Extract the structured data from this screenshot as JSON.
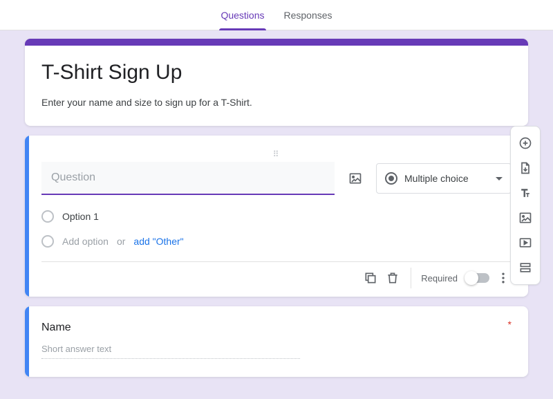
{
  "tabs": {
    "questions": "Questions",
    "responses": "Responses"
  },
  "header": {
    "title": "T-Shirt Sign Up",
    "description": "Enter your name and size to sign up for a T-Shirt."
  },
  "question": {
    "placeholder": "Question",
    "type_label": "Multiple choice",
    "option1": "Option 1",
    "add_option": "Add option",
    "or_text": "or",
    "add_other": "add \"Other\"",
    "required_label": "Required"
  },
  "name_card": {
    "title": "Name",
    "hint": "Short answer text",
    "required_star": "*"
  }
}
